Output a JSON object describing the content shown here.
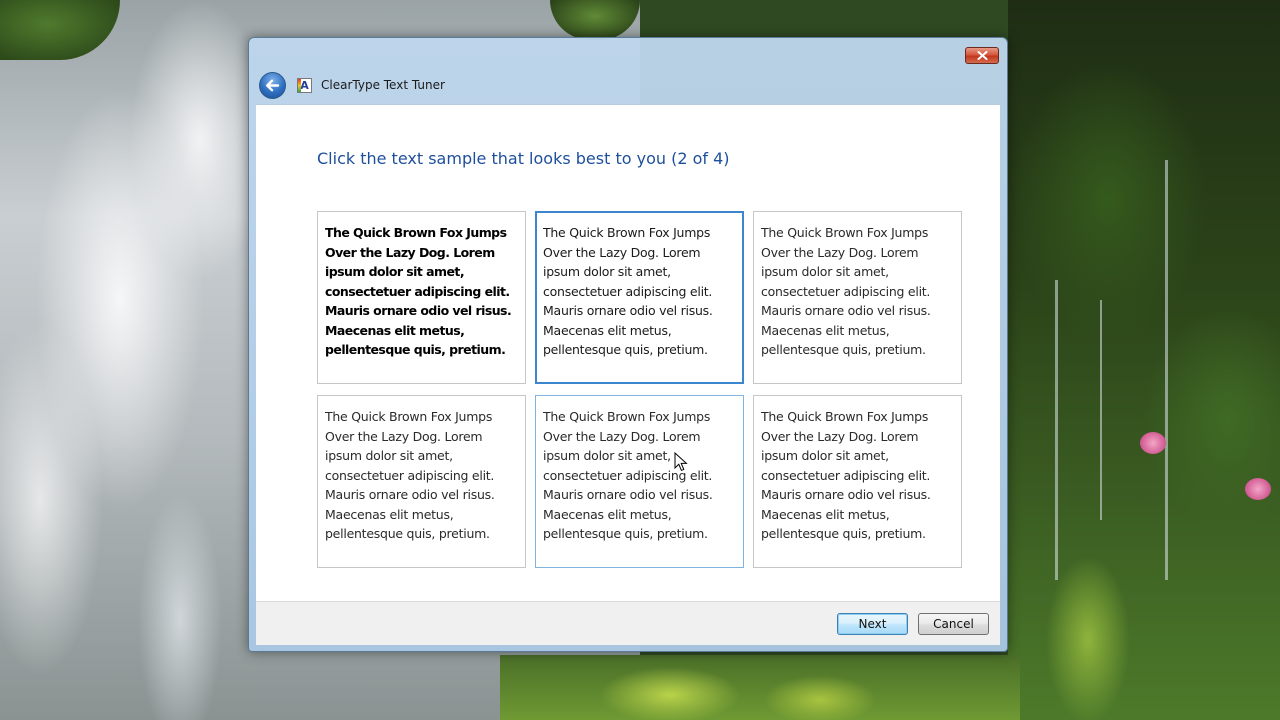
{
  "window": {
    "title": "ClearType Text Tuner"
  },
  "content": {
    "instruction": "Click the text sample that looks best to you (2 of 4)"
  },
  "samples": [
    {
      "text": "The Quick Brown Fox Jumps\nOver the Lazy Dog. Lorem\nipsum dolor sit amet,\nconsectetuer adipiscing elit.\nMauris ornare odio vel risus.\nMaecenas elit metus,\npellentesque quis, pretium.",
      "selected": false
    },
    {
      "text": "The Quick Brown Fox Jumps\nOver the Lazy Dog. Lorem\nipsum dolor sit amet,\nconsectetuer adipiscing elit.\nMauris ornare odio vel risus.\nMaecenas elit metus,\npellentesque quis, pretium.",
      "selected": true
    },
    {
      "text": "The Quick Brown Fox Jumps\nOver the Lazy Dog. Lorem\nipsum dolor sit amet,\nconsectetuer adipiscing elit.\nMauris ornare odio vel risus.\nMaecenas elit metus,\npellentesque quis, pretium.",
      "selected": false
    },
    {
      "text": "The Quick Brown Fox Jumps\nOver the Lazy Dog. Lorem\nipsum dolor sit amet,\nconsectetuer adipiscing elit.\nMauris ornare odio vel risus.\nMaecenas elit metus,\npellentesque quis, pretium.",
      "selected": false
    },
    {
      "text": "The Quick Brown Fox Jumps\nOver the Lazy Dog. Lorem\nipsum dolor sit amet,\nconsectetuer adipiscing elit.\nMauris ornare odio vel risus.\nMaecenas elit metus,\npellentesque quis, pretium.",
      "selected": false
    },
    {
      "text": "The Quick Brown Fox Jumps\nOver the Lazy Dog. Lorem\nipsum dolor sit amet,\nconsectetuer adipiscing elit.\nMauris ornare odio vel risus.\nMaecenas elit metus,\npellentesque quis, pretium.",
      "selected": false
    }
  ],
  "buttons": {
    "next_label": "Next",
    "cancel_label": "Cancel"
  },
  "icons": {
    "close": "close-icon",
    "back": "back-arrow-icon",
    "app": "cleartype-app-icon"
  },
  "colors": {
    "accent": "#1e4f9c",
    "selection_border": "#3b86cc",
    "close_button": "#c7442a"
  }
}
